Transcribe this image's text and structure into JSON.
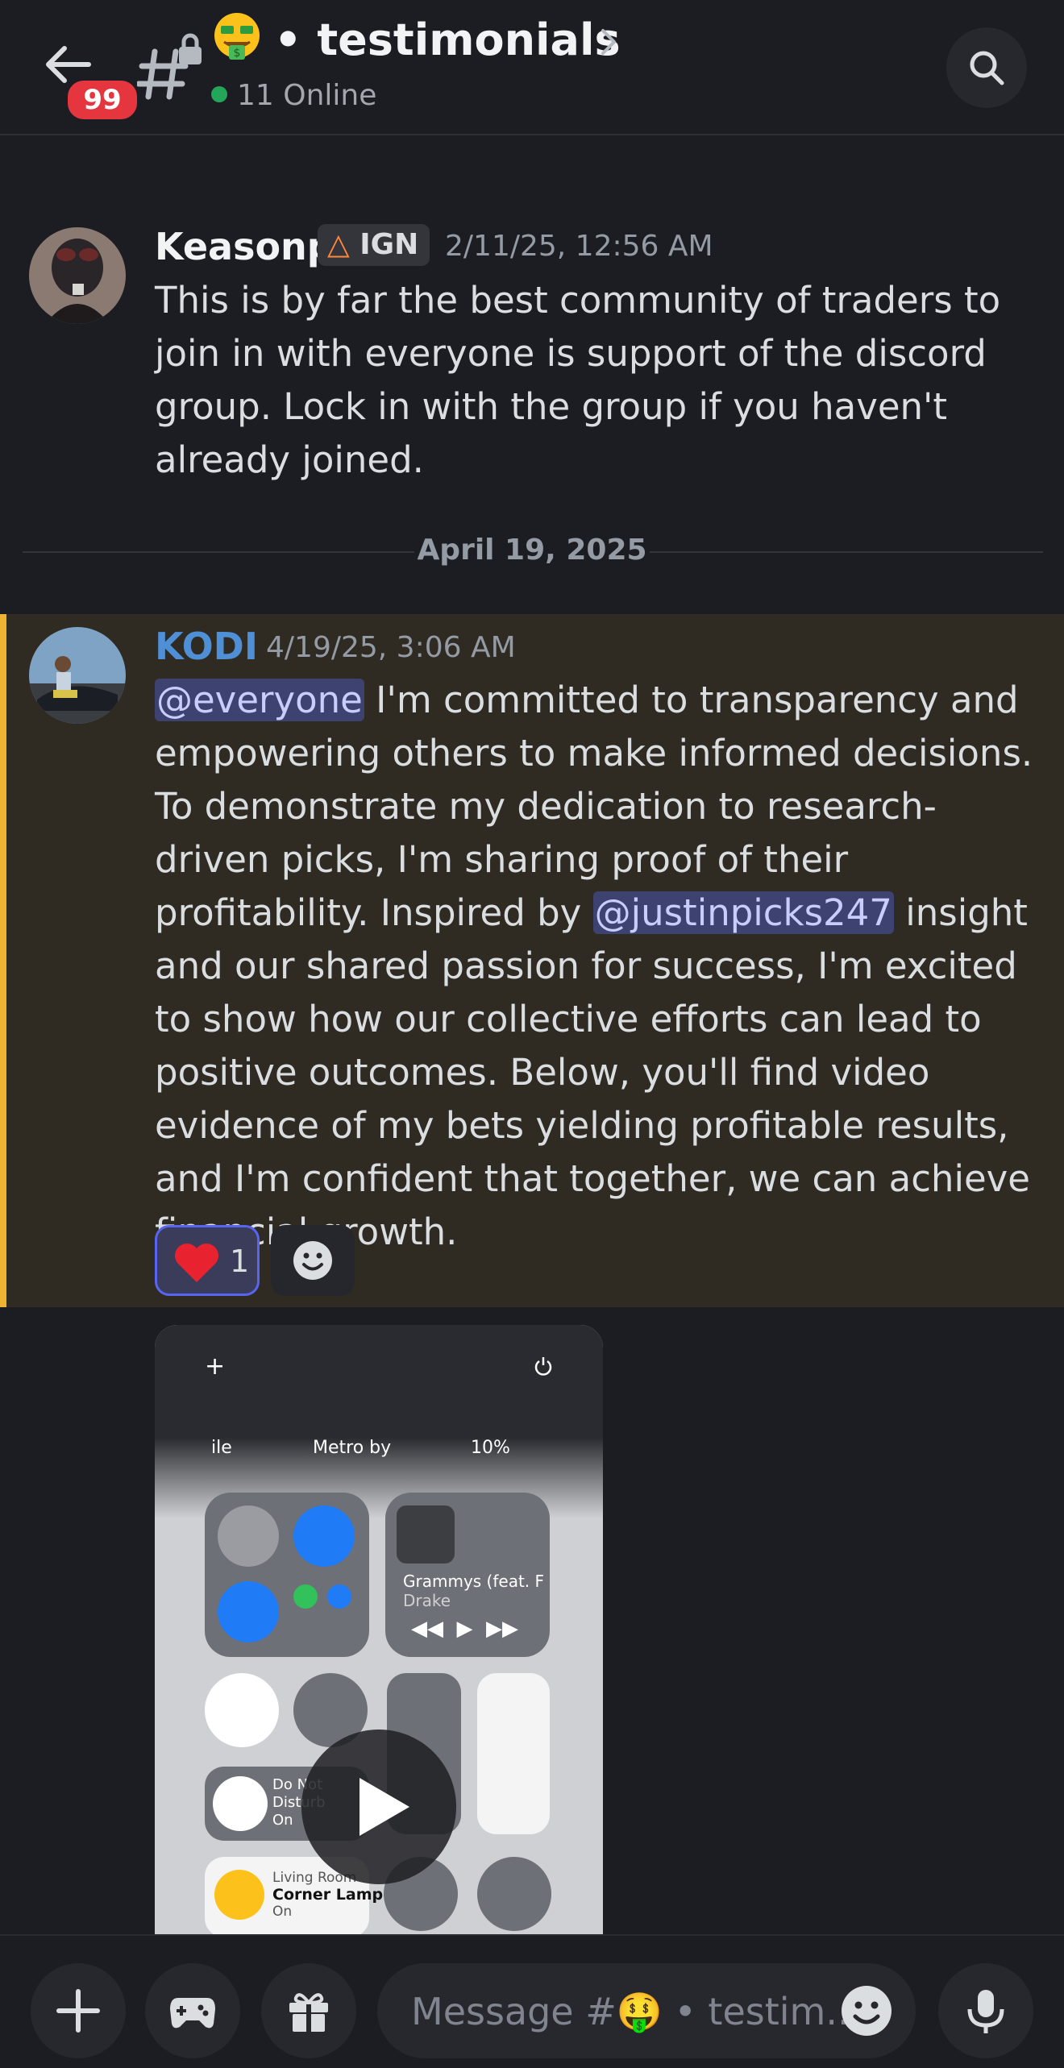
{
  "header": {
    "unread_badge": "99",
    "channel_emoji": "money-mouth-face-emoji",
    "channel_title": "• testimonials",
    "online_text": "11 Online"
  },
  "messages": [
    {
      "author": "Keasonp",
      "role_tag": "IGN",
      "timestamp": "2/11/25, 12:56 AM",
      "text": "This is by far the best community of traders to join in with everyone is support of the discord group. Lock in with the group if you haven't already joined."
    },
    {
      "author": "KODI",
      "timestamp": "4/19/25, 3:06 AM",
      "mention_1": "@everyone",
      "text_1": " I'm committed to transparency and empowering others to make informed decisions. To demonstrate my dedication to research-driven picks, I'm sharing proof of their profitability. Inspired by ",
      "mention_2": "@justinpicks247",
      "text_2": " insight and our shared passion for success, I'm excited to show how our collective efforts can lead to positive outcomes. Below, you'll find video evidence of my bets yielding profitable results, and I'm confident that together, we can achieve financial growth.",
      "reaction_count": "1"
    }
  ],
  "date_divider": "April 19, 2025",
  "video": {
    "status_left": "ile",
    "status_carrier": "Metro by",
    "status_battery": "10%",
    "now_playing_title": "Grammys (feat. F",
    "now_playing_artist": "Drake",
    "dnd_label_1": "Do Not",
    "dnd_label_2": "Disturb",
    "dnd_label_3": "On",
    "home_room": "Living Room",
    "home_device": "Corner Lamp",
    "home_state": "On"
  },
  "composer": {
    "placeholder": "Message #🤑 • testim.."
  },
  "colors": {
    "background": "#1c1d22",
    "accent": "#5865f2",
    "kodi_name": "#4f8fd6",
    "highlight_bar": "#f0b232",
    "online": "#23a55a",
    "badge": "#e5363f"
  }
}
